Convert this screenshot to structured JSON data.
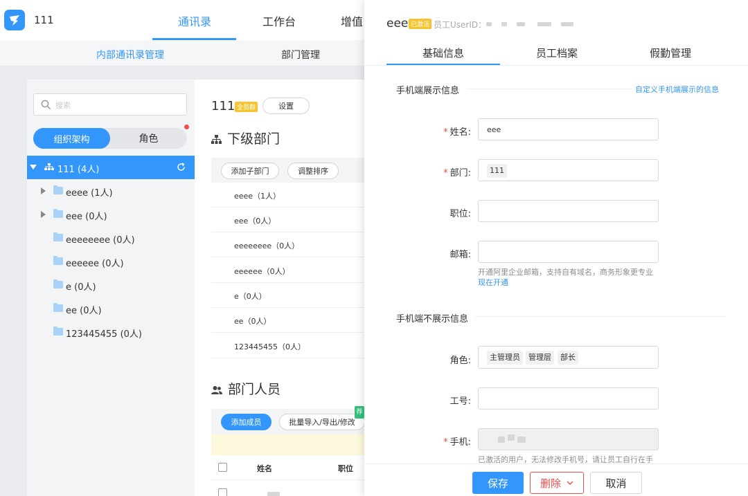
{
  "header": {
    "org_name": "111",
    "tabs": [
      "通讯录",
      "工作台",
      "增值"
    ],
    "active_tab": "通讯录",
    "subnav": [
      "内部通讯录管理",
      "部门管理"
    ]
  },
  "left_panel": {
    "search_placeholder": "搜索",
    "segments": [
      "组织架构",
      "角色"
    ],
    "root": "111 (4人)",
    "tree": [
      {
        "label": "eeee (1人)",
        "expandable": true
      },
      {
        "label": "eee (0人)",
        "expandable": true
      },
      {
        "label": "eeeeeeee (0人)",
        "expandable": false
      },
      {
        "label": "eeeeee (0人)",
        "expandable": false
      },
      {
        "label": "e (0人)",
        "expandable": false
      },
      {
        "label": "ee (0人)",
        "expandable": false
      },
      {
        "label": "123445455 (0人)",
        "expandable": false
      }
    ]
  },
  "center": {
    "title": "111",
    "title_badge": "全员群",
    "settings_label": "设置",
    "sub_dept_heading": "下级部门",
    "add_sub_dept": "添加子部门",
    "reorder": "调整排序",
    "departments": [
      "eeee（1人）",
      "eee（0人）",
      "eeeeeeee（0人）",
      "eeeeee（0人）",
      "e（0人）",
      "ee（0人）",
      "123445455（0人）"
    ],
    "members_heading": "部门人员",
    "add_member": "添加成员",
    "batch_import": "批量导入/导出/修改",
    "green_tag": "荐",
    "col_name": "姓名",
    "col_position": "职位"
  },
  "drawer": {
    "name": "eee",
    "status_badge": "已激活",
    "userid_label": "员工UserID：",
    "tabs": [
      "基础信息",
      "员工档案",
      "假勤管理"
    ],
    "section_shown": "手机端展示信息",
    "customize_link": "自定义手机端展示的信息",
    "fields": {
      "name_label": "姓名:",
      "name_value": "eee",
      "dept_label": "部门:",
      "dept_value": "111",
      "position_label": "职位:",
      "email_label": "邮箱:",
      "email_hint": "开通阿里企业邮箱，支持自有域名，商务形象更专业",
      "email_link": "现在开通"
    },
    "section_hidden": "手机端不展示信息",
    "hidden_fields": {
      "role_label": "角色:",
      "roles": [
        "主管理员",
        "管理层",
        "部长"
      ],
      "job_no_label": "工号:",
      "phone_label": "手机:",
      "phone_hint": "已激活的用户，无法修改手机号，请让员工自行在手"
    },
    "footer": {
      "save": "保存",
      "delete": "删除",
      "cancel": "取消"
    }
  },
  "colors": {
    "accent": "#3296fa",
    "danger": "#ef4b4b",
    "badge": "#f7c431"
  }
}
